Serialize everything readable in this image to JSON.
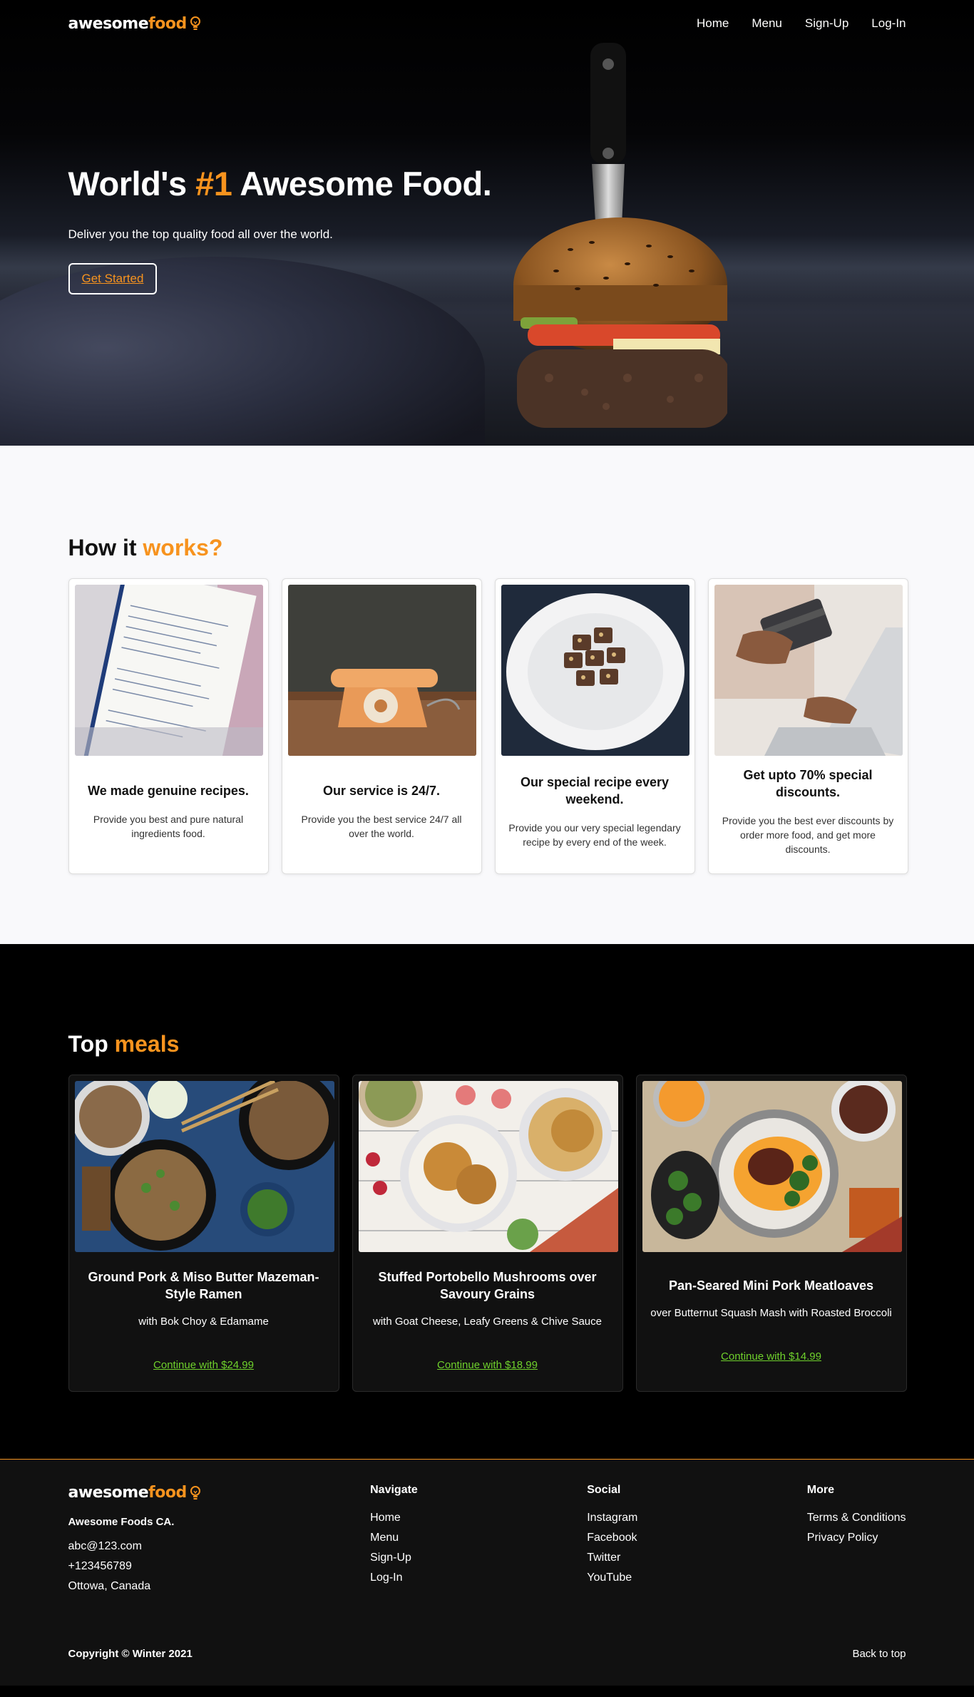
{
  "brand": {
    "part1": "awesome",
    "part2": "food"
  },
  "nav": {
    "items": [
      "Home",
      "Menu",
      "Sign-Up",
      "Log-In"
    ]
  },
  "hero": {
    "title_pre": "World's ",
    "title_accent": "#1",
    "title_post": " Awesome Food.",
    "subtitle": "Deliver you the top quality food all over the world.",
    "cta": "Get Started"
  },
  "how": {
    "title_pre": "How it ",
    "title_accent": "works?",
    "cards": [
      {
        "title": "We made genuine recipes.",
        "text": "Provide you best and pure natural ingredients food.",
        "icon": "recipe-notebook-image"
      },
      {
        "title": "Our service is 24/7.",
        "text": "Provide you the best service 24/7 all over the world.",
        "icon": "telephone-image"
      },
      {
        "title": "Our special recipe every weekend.",
        "text": "Provide you our very special legendary recipe by every end of the week.",
        "icon": "dessert-plate-image"
      },
      {
        "title": "Get upto 70% special discounts.",
        "text": "Provide you the best ever discounts by order more food, and get more discounts.",
        "icon": "card-payment-image"
      }
    ]
  },
  "meals": {
    "title_pre": "Top ",
    "title_accent": "meals",
    "cards": [
      {
        "title": "Ground Pork & Miso Butter Mazeman-Style Ramen",
        "desc": "with Bok Choy & Edamame",
        "cta": "Continue with $24.99"
      },
      {
        "title": "Stuffed Portobello Mushrooms over Savoury Grains",
        "desc": "with Goat Cheese, Leafy Greens & Chive Sauce",
        "cta": "Continue with $18.99"
      },
      {
        "title": "Pan-Seared Mini Pork Meatloaves",
        "desc": "over Butternut Squash Mash with Roasted Broccoli",
        "cta": "Continue with $14.99"
      }
    ]
  },
  "footer": {
    "company": "Awesome Foods CA.",
    "email": "abc@123.com",
    "phone": "+123456789",
    "location": "Ottowa, Canada",
    "navigate": {
      "title": "Navigate",
      "items": [
        "Home",
        "Menu",
        "Sign-Up",
        "Log-In"
      ]
    },
    "social": {
      "title": "Social",
      "items": [
        "Instagram",
        "Facebook",
        "Twitter",
        "YouTube"
      ]
    },
    "more": {
      "title": "More",
      "items": [
        "Terms & Conditions",
        "Privacy Policy"
      ]
    },
    "copyright": "Copyright © Winter 2021",
    "back_to_top": "Back to top"
  },
  "colors": {
    "accent": "#f7931e",
    "price": "#6fd12c",
    "dark": "#000000",
    "light_section": "#f9f9fb"
  }
}
